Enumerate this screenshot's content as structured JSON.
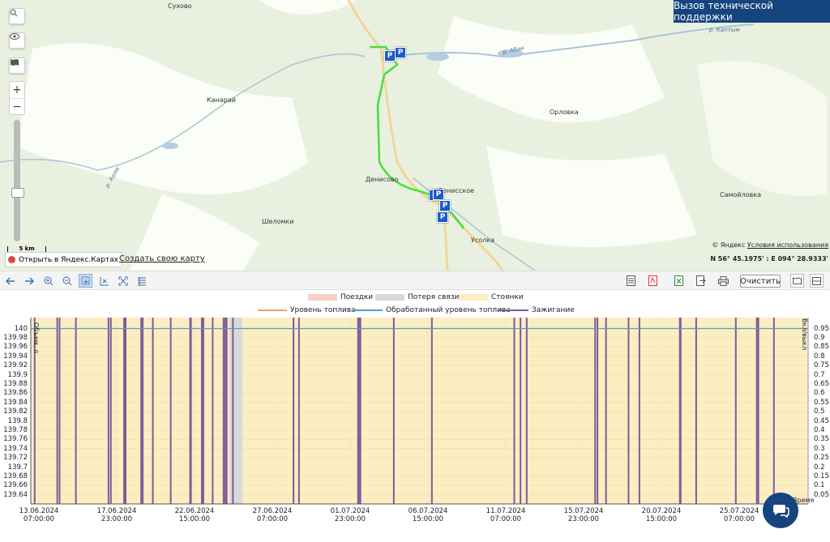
{
  "support_button": "Вызов технической поддержки",
  "map": {
    "labels": [
      {
        "text": "Сухово"
      },
      {
        "text": "Канарай"
      },
      {
        "text": "Орловка"
      },
      {
        "text": "Денисово"
      },
      {
        "text": "Шеломки"
      },
      {
        "text": "Самойловка"
      },
      {
        "text": "Усолка"
      },
      {
        "text": "Денисское"
      },
      {
        "text": "р. Абан"
      },
      {
        "text": "р. Каптым"
      },
      {
        "text": "р. Холм"
      }
    ],
    "parking_label": "P",
    "copyright_prefix": "© Яндекс",
    "copyright_link": "Условия использования",
    "coordinates": "N 56° 45.1975' : E 094° 28.9333'",
    "scale": "5 km",
    "open_yandex": "Открыть в Яндекс.Картах",
    "create_map": "Создать свою карту",
    "controls": [
      "search-icon",
      "eye-icon",
      "layers-icon"
    ],
    "zoom_in": "+",
    "zoom_out": "−",
    "colors": {
      "track": "#44e13c",
      "parking": "#1a5cc8",
      "road": "#f1d59a",
      "water": "#b4cde0",
      "forest": "#d3e6c4"
    }
  },
  "toolbar": {
    "left_icons": [
      "back-icon",
      "forward-icon",
      "zoom-in-icon",
      "zoom-out-icon",
      "zoom-select-icon",
      "zoom-x-icon",
      "fit-icon",
      "list-icon"
    ],
    "right_icons": [
      "report-icon",
      "pdf-icon",
      "excel-icon",
      "export-icon",
      "print-icon"
    ],
    "clear_label": "Очистить",
    "view_icons": [
      "map-view-icon",
      "split-view-icon"
    ]
  },
  "legend": {
    "row1": [
      {
        "label": "Поездки",
        "color": "#f8d0c4"
      },
      {
        "label": "Потеря связи",
        "color": "#d9d9d9"
      },
      {
        "label": "Стоянки",
        "color": "#fbeec0"
      }
    ],
    "row2": [
      {
        "label": "Уровень топлива",
        "color": "#f0a060"
      },
      {
        "label": "Обработанный уровень топлива",
        "color": "#4aa3c8"
      },
      {
        "label": "Зажигание",
        "color": "#7e5a9b"
      }
    ]
  },
  "chart_data": {
    "type": "line",
    "y_left_label": "Объем, л",
    "y_right_label": "Вкл/выкл",
    "y_right_bottom_label": "Время",
    "y_left_ticks": [
      "140",
      "139.98",
      "139.96",
      "139.94",
      "139.92",
      "139.9",
      "139.88",
      "139.86",
      "139.84",
      "139.82",
      "139.8",
      "139.78",
      "139.76",
      "139.74",
      "139.72",
      "139.7",
      "139.68",
      "139.66",
      "139.64"
    ],
    "y_right_ticks": [
      "0.95",
      "0.9",
      "0.85",
      "0.8",
      "0.75",
      "0.7",
      "0.65",
      "0.6",
      "0.55",
      "0.5",
      "0.45",
      "0.4",
      "0.35",
      "0.3",
      "0.25",
      "0.2",
      "0.15",
      "0.1",
      "0.05"
    ],
    "x_ticks": [
      {
        "date": "13.06.2024",
        "time": "07:00:00"
      },
      {
        "date": "17.06.2024",
        "time": "23:00:00"
      },
      {
        "date": "22.06.2024",
        "time": "15:00:00"
      },
      {
        "date": "27.06.2024",
        "time": "07:00:00"
      },
      {
        "date": "01.07.2024",
        "time": "23:00:00"
      },
      {
        "date": "06.07.2024",
        "time": "15:00:00"
      },
      {
        "date": "11.07.2024",
        "time": "07:00:00"
      },
      {
        "date": "15.07.2024",
        "time": "23:00:00"
      },
      {
        "date": "20.07.2024",
        "time": "15:00:00"
      },
      {
        "date": "25.07.2024",
        "time": "07:00:00"
      }
    ],
    "processed_fuel_level": 140,
    "series": [
      {
        "name": "Уровень топлива",
        "color": "#f0a060"
      },
      {
        "name": "Обработанный уровень топлива",
        "color": "#4aa3c8"
      },
      {
        "name": "Зажигание",
        "color": "#7e5a9b"
      }
    ],
    "ignition_events_x": [
      0.005,
      0.034,
      0.037,
      0.058,
      0.1,
      0.103,
      0.12,
      0.122,
      0.142,
      0.144,
      0.157,
      0.18,
      0.205,
      0.206,
      0.22,
      0.222,
      0.234,
      0.248,
      0.25,
      0.252,
      0.26,
      0.338,
      0.345,
      0.421,
      0.422,
      0.424,
      0.467,
      0.516,
      0.622,
      0.63,
      0.638,
      0.726,
      0.729,
      0.74,
      0.769,
      0.783,
      0.835,
      0.836,
      0.856,
      0.907,
      0.934,
      0.936,
      0.956
    ],
    "connection_loss_bands": [
      [
        0.256,
        0.272
      ]
    ],
    "parking_background": true
  }
}
